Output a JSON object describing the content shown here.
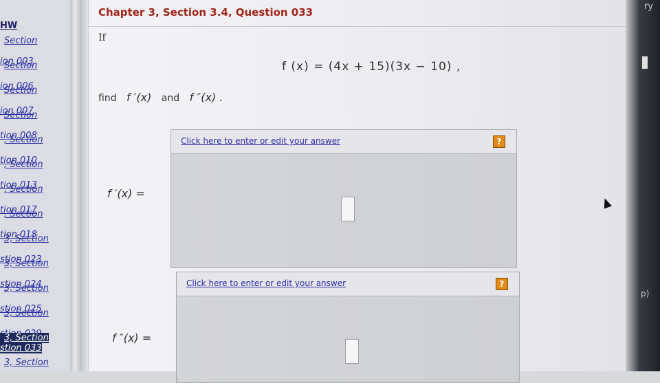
{
  "sidebar": {
    "hw_label": "HW",
    "items": [
      {
        "line1": "Section",
        "line2": "ion 003",
        "active": false
      },
      {
        "line1": "Section",
        "line2": "ion 006",
        "active": false
      },
      {
        "line1": "Section",
        "line2": "ion 007",
        "active": false
      },
      {
        "line1": "Section",
        "line2": "tion 008",
        "active": false
      },
      {
        "line1": ", Section",
        "line2": "tion 010",
        "active": false
      },
      {
        "line1": ", Section",
        "line2": "tion 013",
        "active": false
      },
      {
        "line1": ", Section",
        "line2": "tion 017",
        "active": false
      },
      {
        "line1": ", Section",
        "line2": "tion 018",
        "active": false
      },
      {
        "line1": "3, Section",
        "line2": "stion 023",
        "active": false
      },
      {
        "line1": "3, Section",
        "line2": "stion 024",
        "active": false
      },
      {
        "line1": "3, Section",
        "line2": "stion 025",
        "active": false
      },
      {
        "line1": "3, Section",
        "line2": "stion 029",
        "active": false
      },
      {
        "line1": "3, Section",
        "line2": "stion 033",
        "active": true
      },
      {
        "line1": "3, Section",
        "line2": "",
        "active": false
      }
    ]
  },
  "question": {
    "title": "Chapter 3, Section 3.4, Question 033",
    "if_label": "If",
    "equation": "f (x) = (4x + 15)(3x − 10) ,",
    "find_label": "find",
    "fprime": "f ′(x)",
    "and_label": "and",
    "fdoubleprime": "f ″(x) ."
  },
  "answers": [
    {
      "label": "f ′(x) =",
      "link": "Click here to enter or edit your answer",
      "help": "?"
    },
    {
      "label": "f ″(x) =",
      "link": "Click here to enter or edit your answer",
      "help": "?"
    }
  ],
  "edge": {
    "top_text": "ry",
    "side_text": "p)"
  }
}
